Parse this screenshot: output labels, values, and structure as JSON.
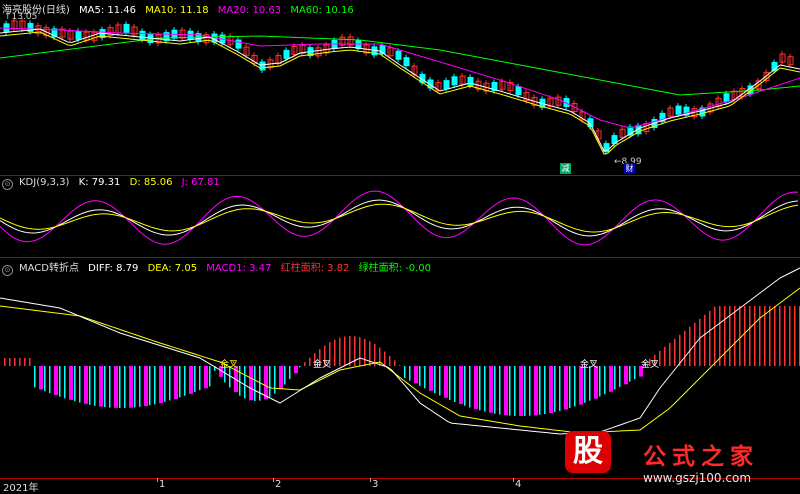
{
  "price": {
    "stock_name": "海亮股份(日线)",
    "ma_labels": [
      {
        "label": "MA5: 11.46",
        "color": "#ffffff"
      },
      {
        "label": "MA10: 11.18",
        "color": "#ffff00"
      },
      {
        "label": "MA20: 10.63",
        "color": "#ff00ff"
      },
      {
        "label": "MA60: 10.16",
        "color": "#00ff00"
      }
    ],
    "high_marker": "13.05",
    "low_marker": "8.99",
    "tag_box_left": "减",
    "tag_box_right": "财"
  },
  "kdj": {
    "name": "KDJ(9,3,3)",
    "values": [
      {
        "label": "K: 79.31",
        "color": "#ffffff"
      },
      {
        "label": "D: 85.06",
        "color": "#ffff00"
      },
      {
        "label": "J: 67.81",
        "color": "#ff00ff"
      }
    ]
  },
  "macd": {
    "name": "MACD转折点",
    "values": [
      {
        "label": "DIFF: 8.79",
        "color": "#ffffff"
      },
      {
        "label": "DEA: 7.05",
        "color": "#ffff00"
      },
      {
        "label": "MACD1: 3.47",
        "color": "#ff00ff"
      }
    ],
    "red_area": "红柱面积: 3.82",
    "green_area": "绿柱面积: -0.00",
    "golden_cross": "金叉",
    "golden_cross_labels": [
      "金叉",
      "金叉",
      "金叉",
      "金叉"
    ]
  },
  "time_axis": {
    "labels": [
      "2021年",
      "1",
      "2",
      "3",
      "4"
    ]
  },
  "watermark": {
    "logo_char": "股",
    "brand": "公式之家",
    "url": "www.gszj100.com"
  },
  "colors": {
    "up": "#ff3333",
    "down": "#00ffff",
    "ma5": "#ffffff",
    "ma10": "#ffff00",
    "ma20": "#ff00ff",
    "ma60": "#00ff00",
    "separator": "#b00000"
  }
}
